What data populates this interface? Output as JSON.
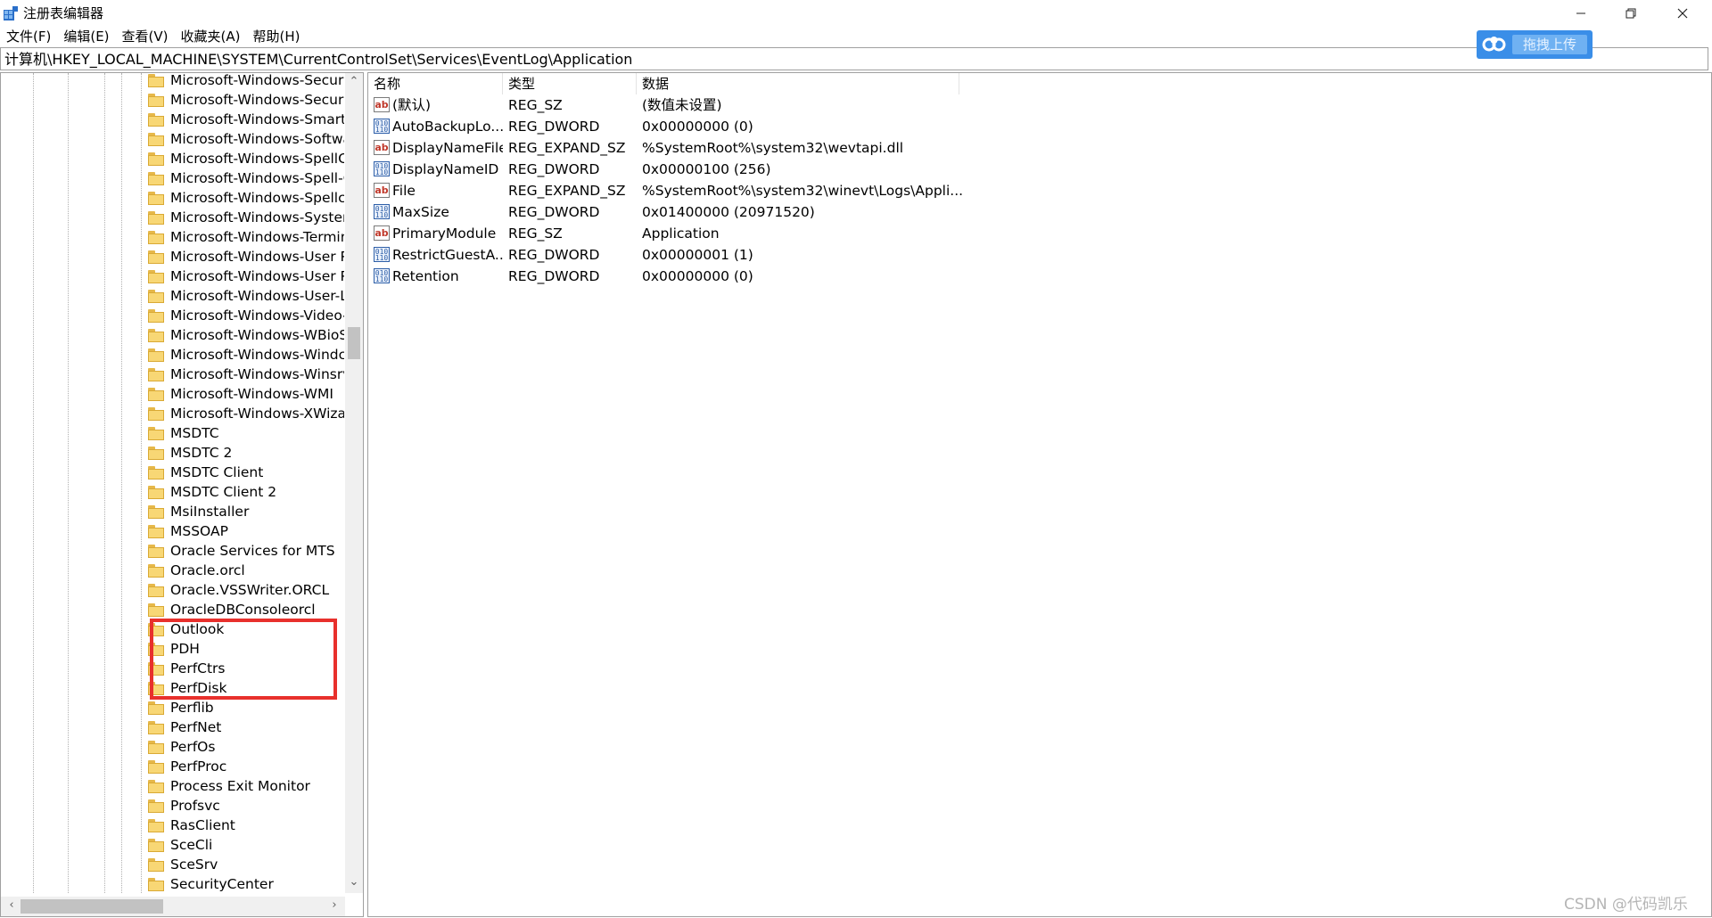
{
  "window": {
    "title": "注册表编辑器"
  },
  "menu": [
    "文件(F)",
    "编辑(E)",
    "查看(V)",
    "收藏夹(A)",
    "帮助(H)"
  ],
  "address": "计算机\\HKEY_LOCAL_MACHINE\\SYSTEM\\CurrentControlSet\\Services\\EventLog\\Application",
  "upload_widget": {
    "label": "拖拽上传"
  },
  "tree": {
    "items": [
      "Microsoft-Windows-Securi",
      "Microsoft-Windows-Securi",
      "Microsoft-Windows-Smartc",
      "Microsoft-Windows-Softwa",
      "Microsoft-Windows-SpellC",
      "Microsoft-Windows-Spell-C",
      "Microsoft-Windows-Spellc",
      "Microsoft-Windows-Syster",
      "Microsoft-Windows-Termin",
      "Microsoft-Windows-User P",
      "Microsoft-Windows-User P",
      "Microsoft-Windows-User-L",
      "Microsoft-Windows-Video-",
      "Microsoft-Windows-WBioS",
      "Microsoft-Windows-Windc",
      "Microsoft-Windows-Winsrv",
      "Microsoft-Windows-WMI",
      "Microsoft-Windows-XWiza",
      "MSDTC",
      "MSDTC 2",
      "MSDTC Client",
      "MSDTC Client 2",
      "MsiInstaller",
      "MSSOAP",
      "Oracle Services for MTS",
      "Oracle.orcl",
      "Oracle.VSSWriter.ORCL",
      "OracleDBConsoleorcl",
      "Outlook",
      "PDH",
      "PerfCtrs",
      "PerfDisk",
      "Perflib",
      "PerfNet",
      "PerfOs",
      "PerfProc",
      "Process Exit Monitor",
      "Profsvc",
      "RasClient",
      "SceCli",
      "SceSrv",
      "SecurityCenter"
    ]
  },
  "values": {
    "columns": [
      "名称",
      "类型",
      "数据"
    ],
    "rows": [
      {
        "icon": "string-value-icon",
        "name": "(默认)",
        "type": "REG_SZ",
        "data": "(数值未设置)"
      },
      {
        "icon": "binary-value-icon",
        "name": "AutoBackupLo...",
        "type": "REG_DWORD",
        "data": "0x00000000 (0)"
      },
      {
        "icon": "string-value-icon",
        "name": "DisplayNameFile",
        "type": "REG_EXPAND_SZ",
        "data": "%SystemRoot%\\system32\\wevtapi.dll"
      },
      {
        "icon": "binary-value-icon",
        "name": "DisplayNameID",
        "type": "REG_DWORD",
        "data": "0x00000100 (256)"
      },
      {
        "icon": "string-value-icon",
        "name": "File",
        "type": "REG_EXPAND_SZ",
        "data": "%SystemRoot%\\system32\\winevt\\Logs\\Appli..."
      },
      {
        "icon": "binary-value-icon",
        "name": "MaxSize",
        "type": "REG_DWORD",
        "data": "0x01400000 (20971520)"
      },
      {
        "icon": "string-value-icon",
        "name": "PrimaryModule",
        "type": "REG_SZ",
        "data": "Application"
      },
      {
        "icon": "binary-value-icon",
        "name": "RestrictGuestA...",
        "type": "REG_DWORD",
        "data": "0x00000001 (1)"
      },
      {
        "icon": "binary-value-icon",
        "name": "Retention",
        "type": "REG_DWORD",
        "data": "0x00000000 (0)"
      }
    ]
  },
  "watermark": "CSDN @代码凯乐",
  "colors": {
    "highlight": "#e8302c",
    "upload": "#3a8ee8",
    "folder": "#f8d775"
  }
}
